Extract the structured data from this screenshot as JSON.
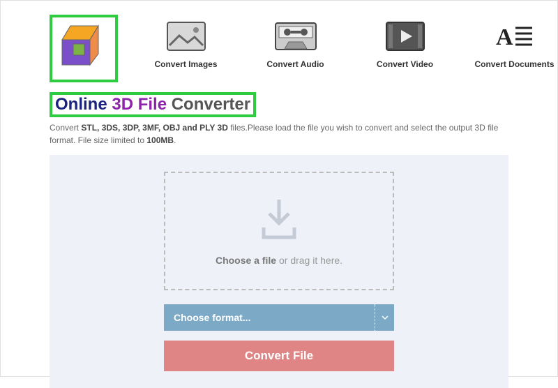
{
  "nav": {
    "images": "Convert Images",
    "audio": "Convert Audio",
    "video": "Convert Video",
    "documents": "Convert Documents"
  },
  "title": {
    "online": "Online",
    "threed": "3D File",
    "converter": "Converter"
  },
  "desc": {
    "pre": "Convert ",
    "bold1": "STL, 3DS, 3DP, 3MF, OBJ and PLY 3D",
    "mid": " files.Please load the file you wish to convert and select the output 3D file format. File size limited to ",
    "bold2": "100MB",
    "post": "."
  },
  "dropzone": {
    "bold": "Choose a file",
    "rest": " or drag it here."
  },
  "format_select": {
    "label": "Choose format..."
  },
  "convert_button": {
    "label": "Convert File"
  }
}
